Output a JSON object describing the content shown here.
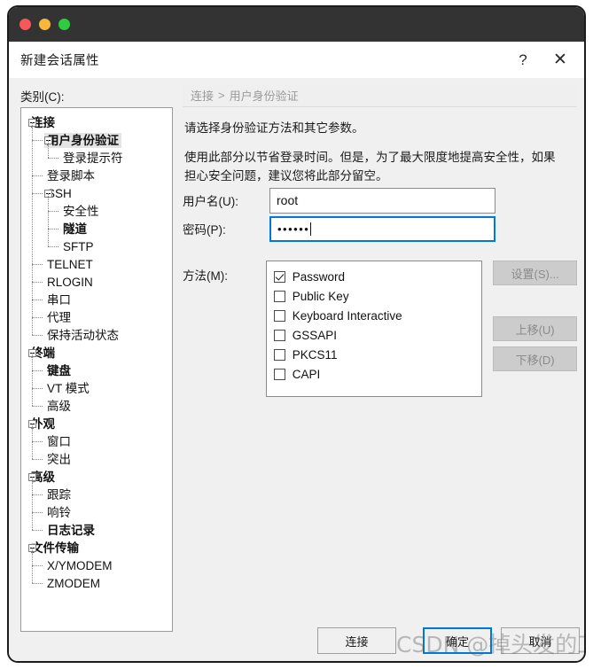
{
  "window": {
    "traffic_lights": [
      "close",
      "minimize",
      "zoom"
    ],
    "colors": {
      "chrome_bg": "#333333",
      "light_red": "#f8575c",
      "light_yellow": "#f6b73c",
      "light_green": "#2ecc40",
      "accent_focus": "#0078d7",
      "body_bg": "#f0f0f0"
    }
  },
  "titlebar": {
    "title": "新建会话属性",
    "help_label": "?",
    "close_label": "✕"
  },
  "category": {
    "label": "类别(C):",
    "tree": [
      {
        "level": 0,
        "label": "连接",
        "expander": "minus",
        "bold": true,
        "selected": false
      },
      {
        "level": 1,
        "label": "用户身份验证",
        "expander": "minus",
        "bold": true,
        "selected": true
      },
      {
        "level": 2,
        "label": "登录提示符",
        "expander": "none",
        "bold": false,
        "selected": false
      },
      {
        "level": 1,
        "label": "登录脚本",
        "expander": "none",
        "bold": false,
        "selected": false
      },
      {
        "level": 1,
        "label": "SSH",
        "expander": "minus",
        "bold": false,
        "selected": false
      },
      {
        "level": 2,
        "label": "安全性",
        "expander": "none",
        "bold": false,
        "selected": false
      },
      {
        "level": 2,
        "label": "隧道",
        "expander": "none",
        "bold": true,
        "selected": false
      },
      {
        "level": 2,
        "label": "SFTP",
        "expander": "none",
        "bold": false,
        "selected": false
      },
      {
        "level": 1,
        "label": "TELNET",
        "expander": "none",
        "bold": false,
        "selected": false
      },
      {
        "level": 1,
        "label": "RLOGIN",
        "expander": "none",
        "bold": false,
        "selected": false
      },
      {
        "level": 1,
        "label": "串口",
        "expander": "none",
        "bold": false,
        "selected": false
      },
      {
        "level": 1,
        "label": "代理",
        "expander": "none",
        "bold": false,
        "selected": false
      },
      {
        "level": 1,
        "label": "保持活动状态",
        "expander": "none",
        "bold": false,
        "selected": false
      },
      {
        "level": 0,
        "label": "终端",
        "expander": "minus",
        "bold": true,
        "selected": false
      },
      {
        "level": 1,
        "label": "键盘",
        "expander": "none",
        "bold": true,
        "selected": false
      },
      {
        "level": 1,
        "label": "VT 模式",
        "expander": "none",
        "bold": false,
        "selected": false
      },
      {
        "level": 1,
        "label": "高级",
        "expander": "none",
        "bold": false,
        "selected": false
      },
      {
        "level": 0,
        "label": "外观",
        "expander": "minus",
        "bold": true,
        "selected": false
      },
      {
        "level": 1,
        "label": "窗口",
        "expander": "none",
        "bold": false,
        "selected": false
      },
      {
        "level": 1,
        "label": "突出",
        "expander": "none",
        "bold": false,
        "selected": false
      },
      {
        "level": 0,
        "label": "高级",
        "expander": "minus",
        "bold": true,
        "selected": false
      },
      {
        "level": 1,
        "label": "跟踪",
        "expander": "none",
        "bold": false,
        "selected": false
      },
      {
        "level": 1,
        "label": "响铃",
        "expander": "none",
        "bold": false,
        "selected": false
      },
      {
        "level": 1,
        "label": "日志记录",
        "expander": "none",
        "bold": true,
        "selected": false
      },
      {
        "level": 0,
        "label": "文件传输",
        "expander": "minus",
        "bold": true,
        "selected": false
      },
      {
        "level": 1,
        "label": "X/YMODEM",
        "expander": "none",
        "bold": false,
        "selected": false
      },
      {
        "level": 1,
        "label": "ZMODEM",
        "expander": "none",
        "bold": false,
        "selected": false
      }
    ]
  },
  "content": {
    "breadcrumb": {
      "root": "连接",
      "separator": ">",
      "current": "用户身份验证"
    },
    "paragraph1": "请选择身份验证方法和其它参数。",
    "paragraph2": "使用此部分以节省登录时间。但是，为了最大限度地提高安全性，如果担心安全问题，建议您将此部分留空。",
    "fields": {
      "username": {
        "label": "用户名(U):",
        "value": "root",
        "placeholder": ""
      },
      "password": {
        "label": "密码(P):",
        "value": "••••••",
        "placeholder": "",
        "focused": true
      }
    },
    "methods": {
      "label": "方法(M):",
      "items": [
        {
          "label": "Password",
          "checked": true
        },
        {
          "label": "Public Key",
          "checked": false
        },
        {
          "label": "Keyboard Interactive",
          "checked": false
        },
        {
          "label": "GSSAPI",
          "checked": false
        },
        {
          "label": "PKCS11",
          "checked": false
        },
        {
          "label": "CAPI",
          "checked": false
        }
      ]
    },
    "side_buttons": [
      {
        "label": "设置(S)...",
        "disabled": true
      },
      {
        "label": "上移(U)",
        "disabled": true
      },
      {
        "label": "下移(D)",
        "disabled": true
      }
    ]
  },
  "footer": {
    "buttons": [
      {
        "id": "connect",
        "label": "连接",
        "focused": false
      },
      {
        "id": "ok",
        "label": "确定",
        "focused": true
      },
      {
        "id": "cancel",
        "label": "取消",
        "focused": false
      }
    ]
  },
  "watermark": {
    "text": "CSDN @掉头发的工富贵"
  }
}
